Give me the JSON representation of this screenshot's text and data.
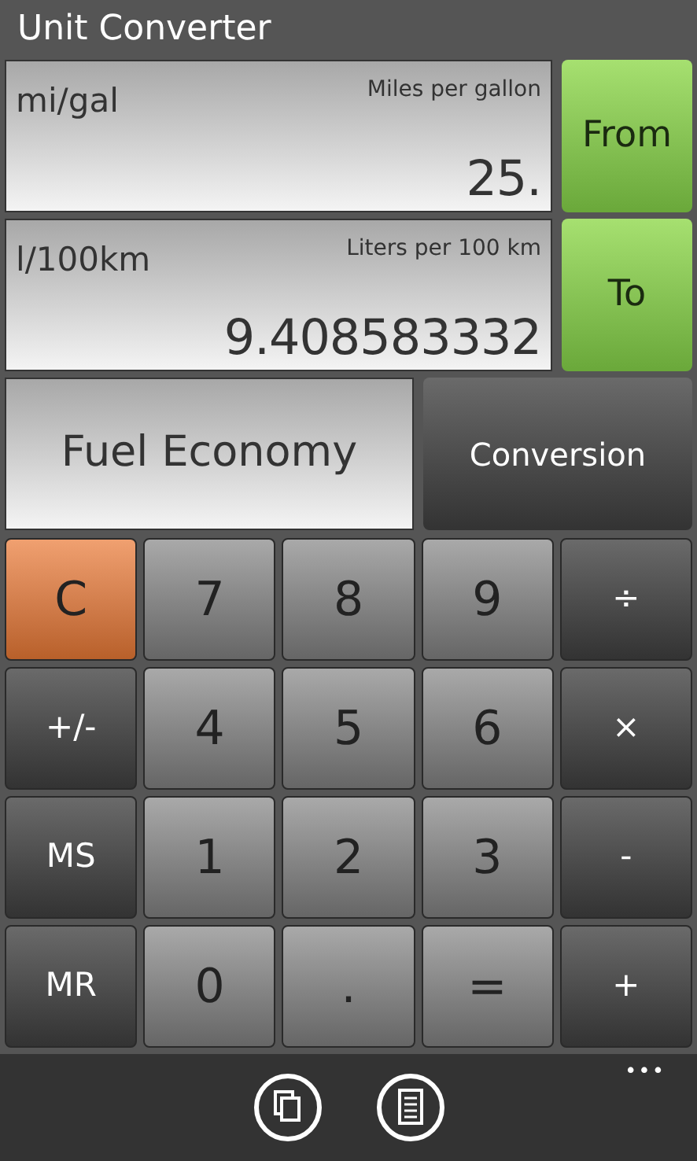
{
  "title": "Unit Converter",
  "fields": [
    {
      "unit": "mi/gal",
      "name": "Miles per gallon",
      "value": "25.",
      "button": "From"
    },
    {
      "unit": "l/100km",
      "name": "Liters per 100 km",
      "value": "9.408583332",
      "button": "To"
    }
  ],
  "category": "Fuel Economy",
  "mode_button": "Conversion",
  "keys": [
    {
      "label": "C",
      "kind": "clear"
    },
    {
      "label": "7",
      "kind": "digit"
    },
    {
      "label": "8",
      "kind": "digit"
    },
    {
      "label": "9",
      "kind": "digit"
    },
    {
      "label": "÷",
      "kind": "op"
    },
    {
      "label": "+/-",
      "kind": "op"
    },
    {
      "label": "4",
      "kind": "digit"
    },
    {
      "label": "5",
      "kind": "digit"
    },
    {
      "label": "6",
      "kind": "digit"
    },
    {
      "label": "×",
      "kind": "op"
    },
    {
      "label": "MS",
      "kind": "op"
    },
    {
      "label": "1",
      "kind": "digit"
    },
    {
      "label": "2",
      "kind": "digit"
    },
    {
      "label": "3",
      "kind": "digit"
    },
    {
      "label": "-",
      "kind": "op"
    },
    {
      "label": "MR",
      "kind": "op"
    },
    {
      "label": "0",
      "kind": "digit"
    },
    {
      "label": ".",
      "kind": "digit"
    },
    {
      "label": "=",
      "kind": "digit"
    },
    {
      "label": "+",
      "kind": "op"
    }
  ],
  "app_bar": {
    "more": "•••"
  }
}
